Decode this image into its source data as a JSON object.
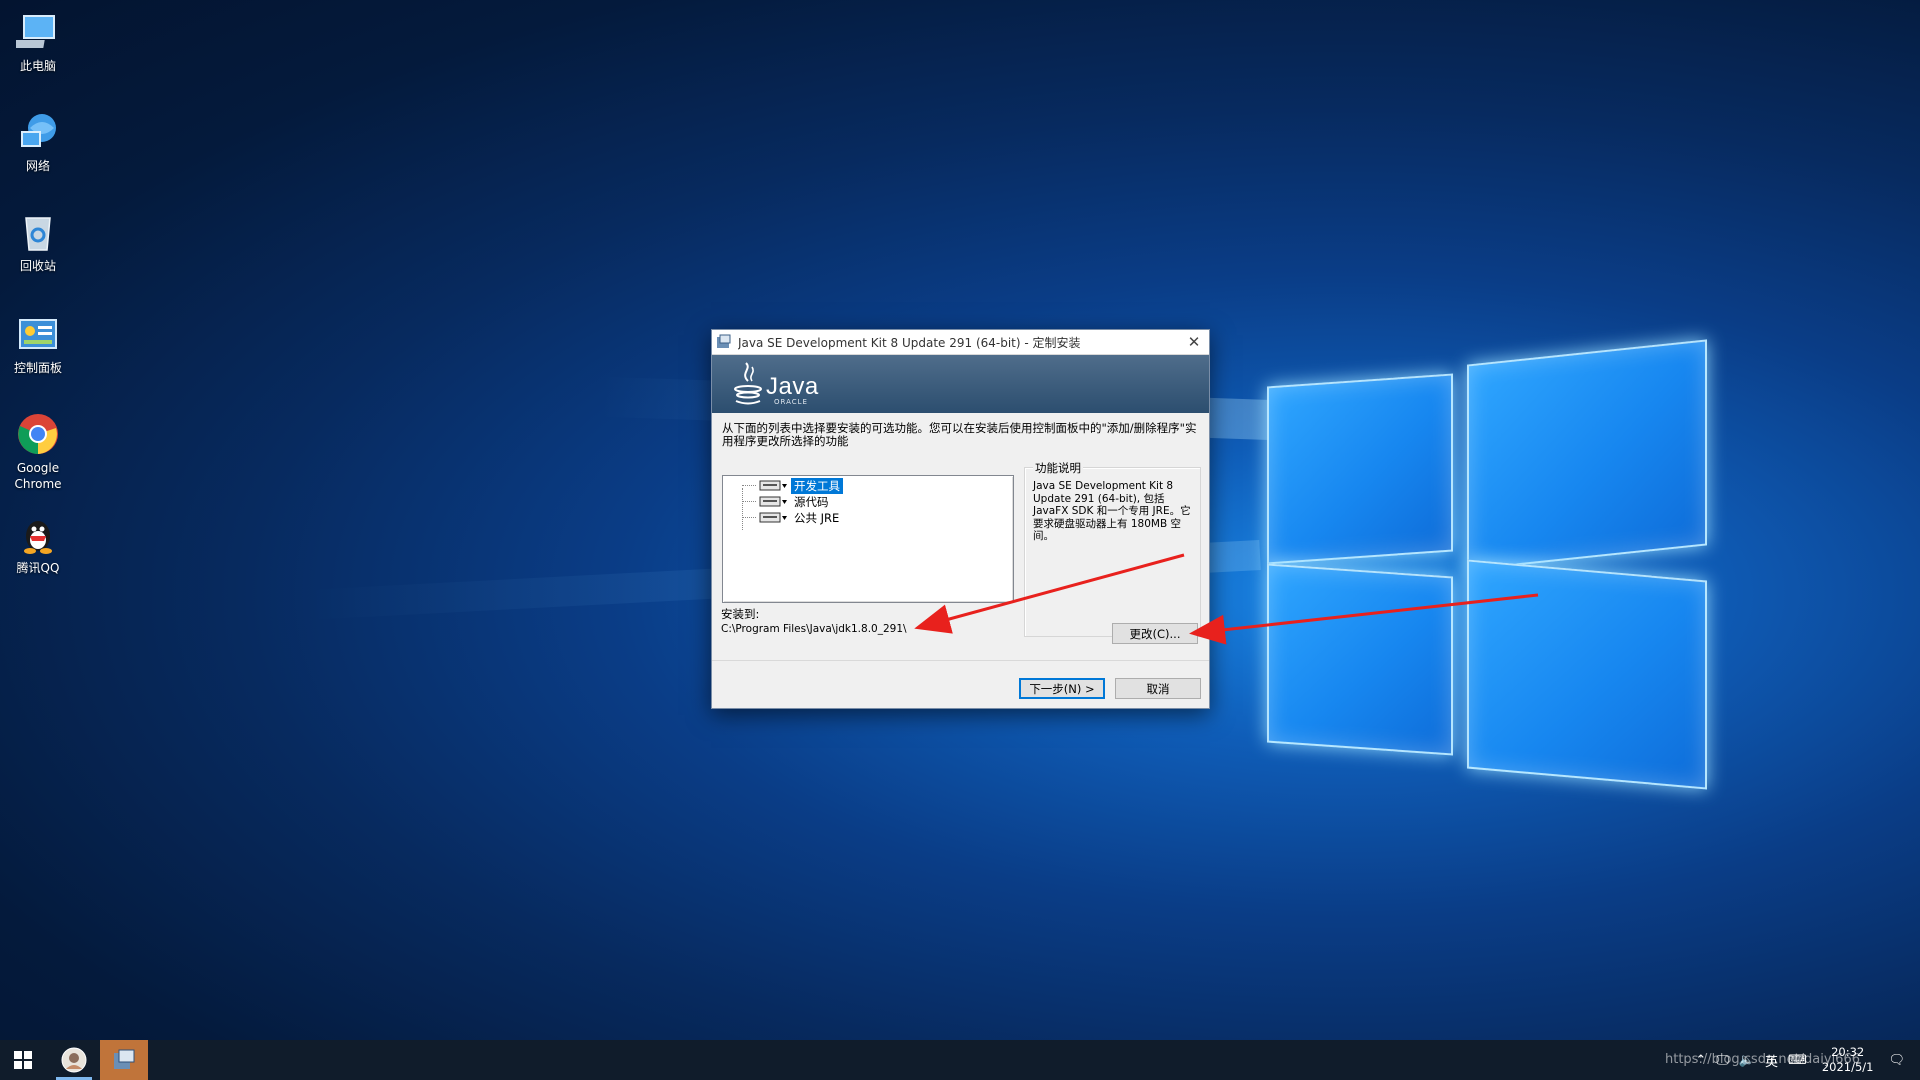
{
  "desktop": {
    "icons": [
      {
        "label": "此电脑",
        "icon": "computer-icon"
      },
      {
        "label": "网络",
        "icon": "network-icon"
      },
      {
        "label": "回收站",
        "icon": "recycle-bin-icon"
      },
      {
        "label": "控制面板",
        "icon": "control-panel-icon"
      },
      {
        "label": "Google Chrome",
        "icon": "chrome-icon"
      },
      {
        "label": "腾讯QQ",
        "icon": "qq-icon"
      }
    ]
  },
  "dialog": {
    "title": "Java SE Development Kit 8 Update 291 (64-bit) - 定制安装",
    "banner": {
      "logo_text": "Java",
      "logo_sub": "ORACLE"
    },
    "instruction": "从下面的列表中选择要安装的可选功能。您可以在安装后使用控制面板中的\"添加/删除程序\"实用程序更改所选择的功能",
    "features": [
      {
        "label": "开发工具",
        "selected": true
      },
      {
        "label": "源代码",
        "selected": false
      },
      {
        "label": "公共 JRE",
        "selected": false
      }
    ],
    "feature_panel": {
      "title": "功能说明",
      "body": "Java SE Development Kit 8 Update 291 (64-bit), 包括 JavaFX SDK 和一个专用 JRE。它要求硬盘驱动器上有 180MB 空间。"
    },
    "install_to_label": "安装到:",
    "install_path": "C:\\Program Files\\Java\\jdk1.8.0_291\\",
    "buttons": {
      "change": "更改(C)...",
      "next": "下一步(N) >",
      "cancel": "取消"
    }
  },
  "taskbar": {
    "apps": [
      "start-icon",
      "qq-avatar-icon",
      "java-installer-icon"
    ],
    "tray": {
      "ime": "英",
      "time": "20:32",
      "date": "2021/5/1"
    },
    "watermark": "https://blog.csdn.net/daiyi666"
  },
  "colors": {
    "accent": "#0078d7",
    "annotation_arrow": "#e8211d",
    "banner": "#3a5a7b"
  }
}
